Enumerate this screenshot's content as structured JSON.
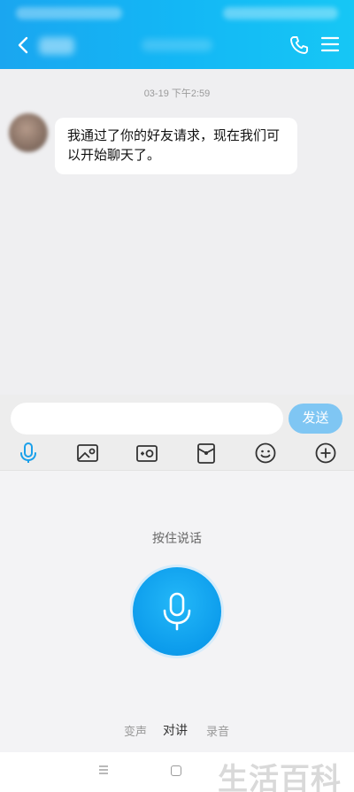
{
  "chat": {
    "timestamp": "03-19 下午2:59",
    "messages": [
      {
        "text": "我通过了你的好友请求，现在我们可以开始聊天了。"
      }
    ]
  },
  "input": {
    "value": "",
    "send_label": "发送"
  },
  "toolbar": {
    "items": [
      "voice-icon",
      "image-icon",
      "camera-icon",
      "red-packet-icon",
      "emoji-icon",
      "plus-icon"
    ]
  },
  "voice_panel": {
    "hold_label": "按住说话",
    "modes": [
      "变声",
      "对讲",
      "录音"
    ],
    "active_mode": "对讲"
  },
  "watermark": "生活百科",
  "colors": {
    "accent": "#12a7f0",
    "send_button": "#7fc6f3",
    "active_tool": "#1aa0ea"
  }
}
